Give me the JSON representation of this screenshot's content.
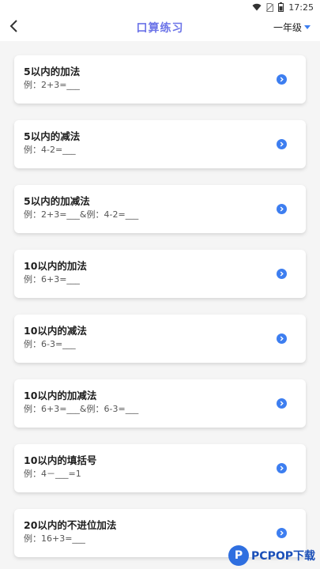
{
  "status_bar": {
    "time": "17:25",
    "icons": [
      "wifi-icon",
      "no-sim-icon",
      "battery-icon"
    ]
  },
  "header": {
    "title": "口算练习",
    "grade_selector": "一年级"
  },
  "exercises": [
    {
      "title": "5以内的加法",
      "example": "例：2+3=___"
    },
    {
      "title": "5以内的减法",
      "example": "例：4-2=___"
    },
    {
      "title": "5以内的加减法",
      "example": "例：2+3=___&例：4-2=___"
    },
    {
      "title": "10以内的加法",
      "example": "例：6+3=___"
    },
    {
      "title": "10以内的减法",
      "example": "例：6-3=___"
    },
    {
      "title": "10以内的加减法",
      "example": "例：6+3=___&例：6-3=___"
    },
    {
      "title": "10以内的填括号",
      "example": "例：4－___=1"
    },
    {
      "title": "20以内的不进位加法",
      "example": "例：16+3=___"
    }
  ],
  "watermark": {
    "logo_letter": "P",
    "text": "PCPOP下载"
  },
  "colors": {
    "accent": "#6c74e8",
    "arrow": "#3d7ef0",
    "background": "#f5f5f5"
  }
}
